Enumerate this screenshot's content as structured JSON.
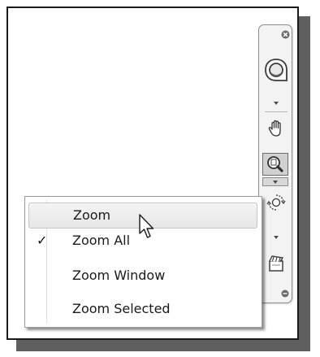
{
  "navigation_bar": {
    "close_icon": "close-icon",
    "buttons": [
      {
        "name": "steering-wheel-icon"
      },
      {
        "name": "pan-hand-icon"
      },
      {
        "name": "zoom-magnifier-icon",
        "active": true
      },
      {
        "name": "orbit-icon"
      },
      {
        "name": "showmotion-icon"
      }
    ]
  },
  "zoom_menu": {
    "items": [
      {
        "label": "Zoom",
        "checked": false,
        "hovered": true
      },
      {
        "label": "Zoom All",
        "checked": true,
        "hovered": false
      },
      {
        "label": "Zoom Window",
        "checked": false,
        "hovered": false
      },
      {
        "label": "Zoom Selected",
        "checked": false,
        "hovered": false
      }
    ],
    "check_glyph": "✓"
  },
  "colors": {
    "frame_border": "#1a1a1a",
    "shadow": "#5f5f5f",
    "navbar_bg": "#f3f3f3",
    "active_button_bg": "#d0d0d0"
  }
}
